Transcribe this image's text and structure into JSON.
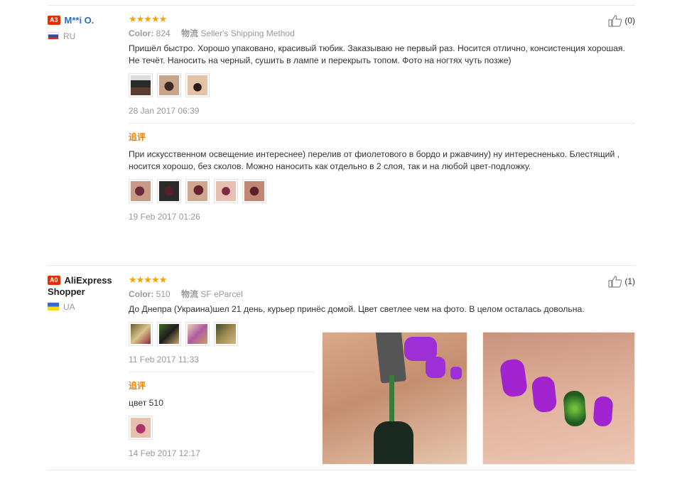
{
  "reviews": [
    {
      "level": "A3",
      "name": "M**i O.",
      "country": "RU",
      "stars": "★★★★★",
      "color_label": "Color:",
      "color_value": "824",
      "shipping_label": "物流",
      "shipping_value": "Seller's Shipping Method",
      "text": "Пришёл быстро. Хорошо упаковано, красивый тюбик. Заказываю не первый раз. Носится отлично, консистенция хорошая. Не течёт. Наносить на черный, сушить в лампе и перекрыть топом. Фото на ногтях чуть позже)",
      "date": "28 Jan 2017 06:39",
      "likes": "(0)",
      "followup": {
        "label": "追评",
        "text": "При искусственном освещение интереснее) перелив от фиолетового в бордо и ржавчину) ну интересненько. Блестящий , носится хорошо, без сколов. Можно наносить как отдельно в 2 слоя, так и на любой цвет-подложку.",
        "date": "19 Feb 2017 01:26"
      }
    },
    {
      "level": "A0",
      "name": "AliExpress Shopper",
      "country": "UA",
      "stars": "★★★★★",
      "color_label": "Color:",
      "color_value": "510",
      "shipping_label": "物流",
      "shipping_value": "SF eParcel",
      "text": "До Днепра (Украина)шел 21 день, курьер принёс домой. Цвет светлее чем на фото. В целом осталась довольна.",
      "date": "11 Feb 2017 11:33",
      "likes": "(1)",
      "followup": {
        "label": "追评",
        "text": "цвет 510",
        "date": "14 Feb 2017 12:17"
      }
    }
  ]
}
